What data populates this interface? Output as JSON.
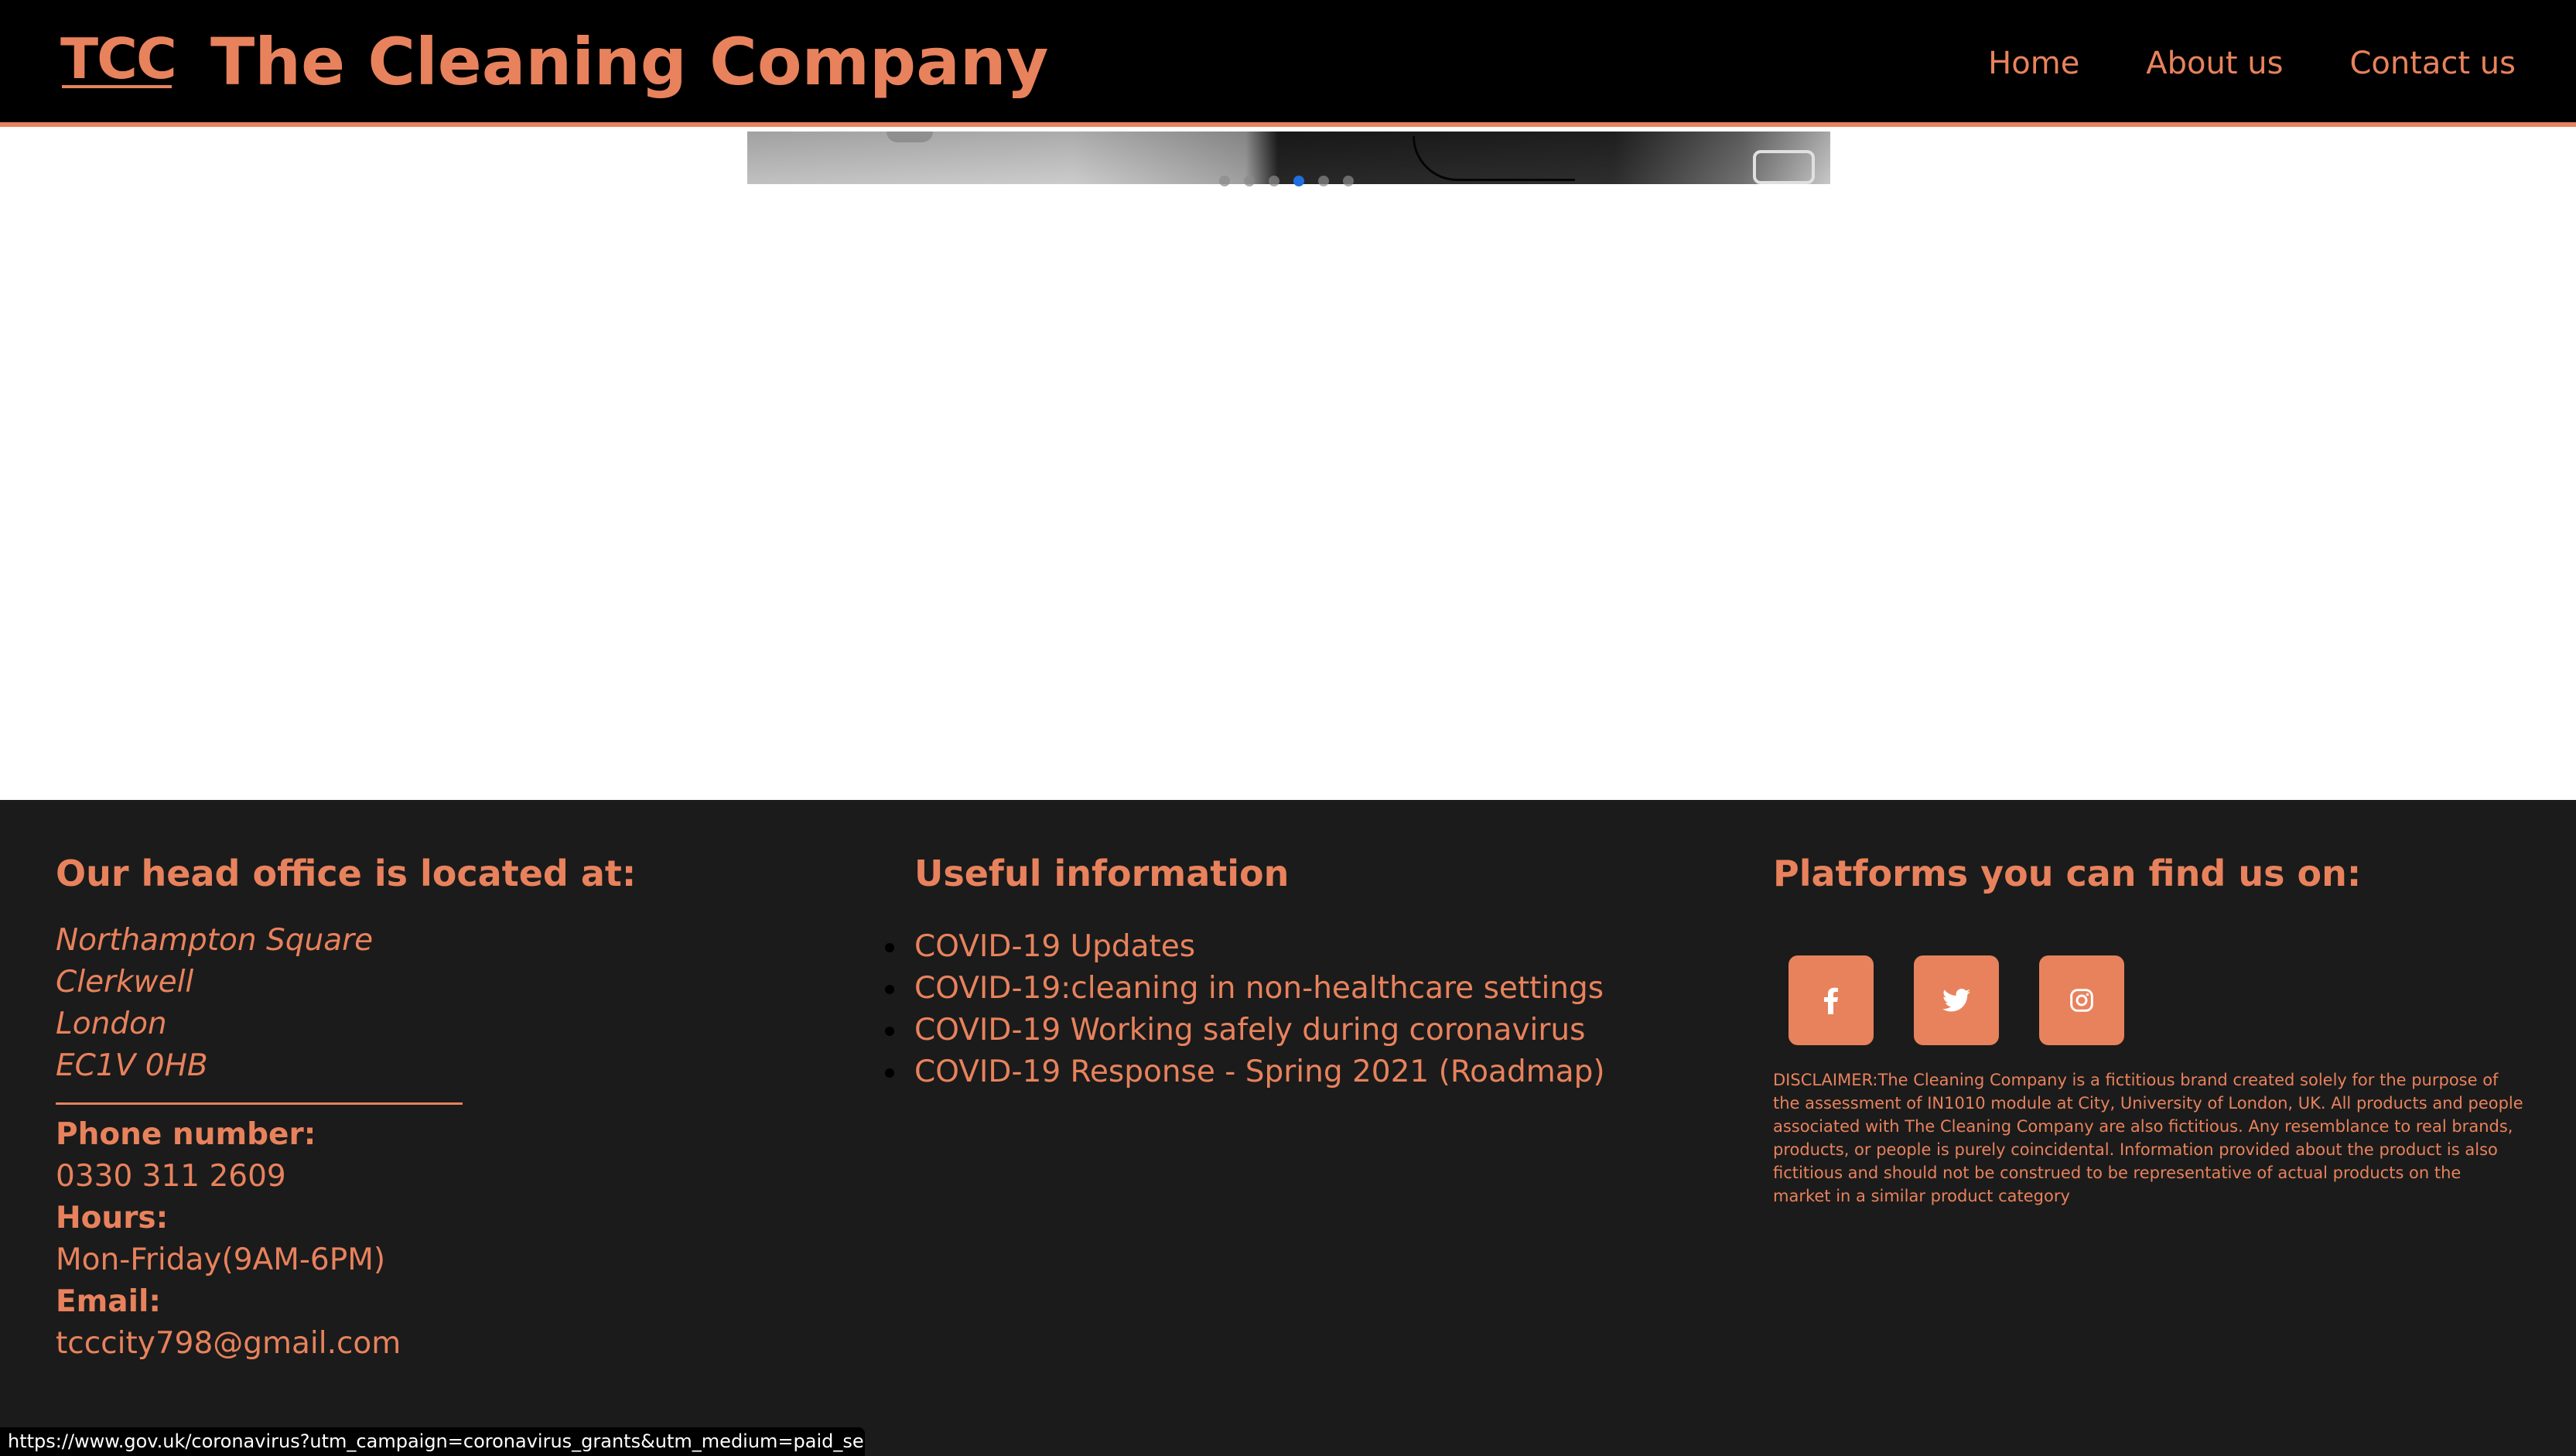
{
  "header": {
    "logo": "TCC",
    "brand": "The Cleaning Company",
    "nav": [
      "Home",
      "About us",
      "Contact us"
    ],
    "accent_color": "#e8825c",
    "background_color": "#000000"
  },
  "carousel": {
    "indicator_count": 6,
    "active_index": 3
  },
  "footer": {
    "office": {
      "heading": "Our head office is located at:",
      "address": [
        "Northampton Square",
        "Clerkwell",
        "London",
        "EC1V 0HB"
      ],
      "phone_label": "Phone number:",
      "phone": "0330 311 2609",
      "hours_label": "Hours:",
      "hours": "Mon-Friday(9AM-6PM)",
      "email_label": "Email:",
      "email": "tcccity798@gmail.com"
    },
    "info": {
      "heading": "Useful information",
      "links": [
        "COVID-19 Updates",
        "COVID-19:cleaning in non-healthcare settings",
        "COVID-19 Working safely during coronavirus",
        "COVID-19 Response - Spring 2021 (Roadmap)"
      ]
    },
    "platforms": {
      "heading": "Platforms you can find us on:",
      "icons": [
        "facebook-icon",
        "twitter-icon",
        "instagram-icon"
      ],
      "disclaimer": "DISCLAIMER:The Cleaning Company is a fictitious brand created solely for the purpose of the assessment of IN1010 module at City, University of London, UK. All products and people associated with The Cleaning Company are also fictitious. Any resemblance to real brands, products, or people is purely coincidental. Information provided about the product is also fictitious and should not be construed to be representative of actual products on the market in a similar product category"
    },
    "background_color": "#1b1b1b"
  },
  "status_bar": {
    "url": "https://www.gov.uk/coronavirus?utm_campaign=coronavirus_grants&utm_medium=paid_searc..."
  }
}
